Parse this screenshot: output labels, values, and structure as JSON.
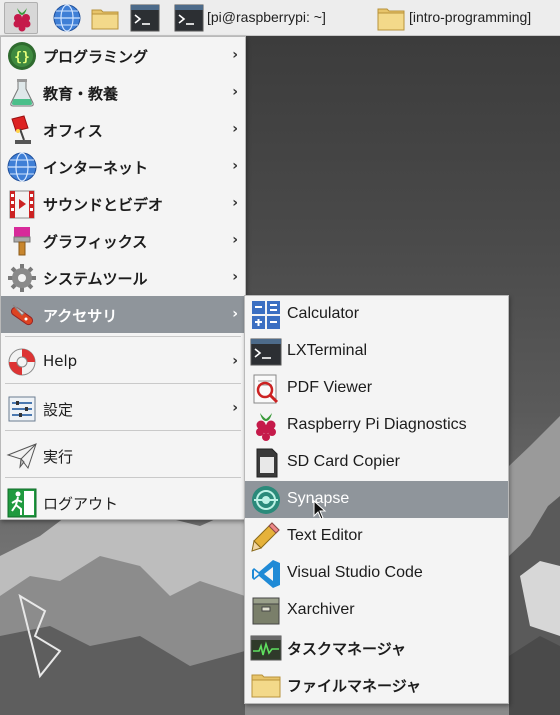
{
  "taskbar": {
    "terminal_window_title": "[pi@raspberrypi: ~]",
    "folder_window_title": "[intro-programming]",
    "icons": [
      "raspberry-menu-icon",
      "web-browser-icon",
      "file-manager-icon",
      "terminal-icon"
    ]
  },
  "main_menu": {
    "items": [
      {
        "label": "プログラミング",
        "icon": "programming-icon",
        "has_submenu": true
      },
      {
        "label": "教育・教養",
        "icon": "education-flask-icon",
        "has_submenu": true
      },
      {
        "label": "オフィス",
        "icon": "office-lamp-icon",
        "has_submenu": true
      },
      {
        "label": "インターネット",
        "icon": "globe-icon",
        "has_submenu": true
      },
      {
        "label": "サウンドとビデオ",
        "icon": "sound-video-icon",
        "has_submenu": true
      },
      {
        "label": "グラフィックス",
        "icon": "paintbrush-icon",
        "has_submenu": true
      },
      {
        "label": "システムツール",
        "icon": "gear-icon",
        "has_submenu": true
      },
      {
        "label": "アクセサリ",
        "icon": "swiss-knife-icon",
        "has_submenu": true,
        "selected": true
      },
      {
        "label": "Help",
        "icon": "lifebuoy-icon",
        "has_submenu": true
      },
      {
        "label": "設定",
        "icon": "settings-icon",
        "has_submenu": true
      },
      {
        "label": "実行",
        "icon": "paper-plane-icon",
        "has_submenu": false
      },
      {
        "label": "ログアウト",
        "icon": "exit-icon",
        "has_submenu": false
      }
    ]
  },
  "accessories_menu": {
    "items": [
      {
        "label": "Calculator",
        "icon": "calculator-icon"
      },
      {
        "label": "LXTerminal",
        "icon": "terminal-icon"
      },
      {
        "label": "PDF Viewer",
        "icon": "pdf-viewer-icon"
      },
      {
        "label": "Raspberry Pi Diagnostics",
        "icon": "raspberry-icon"
      },
      {
        "label": "SD Card Copier",
        "icon": "sd-card-icon"
      },
      {
        "label": "Synapse",
        "icon": "synapse-icon",
        "hovered": true
      },
      {
        "label": "Text Editor",
        "icon": "pencil-icon"
      },
      {
        "label": "Visual Studio Code",
        "icon": "vscode-icon"
      },
      {
        "label": "Xarchiver",
        "icon": "archive-icon"
      },
      {
        "label": "タスクマネージャ",
        "icon": "task-manager-icon"
      },
      {
        "label": "ファイルマネージャ",
        "icon": "folder-icon"
      }
    ]
  },
  "colors": {
    "menu_background": "#f4f4f4",
    "selection": "#8f959b",
    "taskbar": "#ededed"
  }
}
